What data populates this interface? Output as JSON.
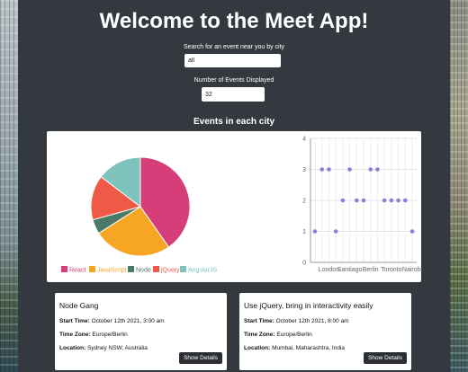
{
  "header": {
    "title": "Welcome to the Meet App!"
  },
  "search": {
    "label": "Search for an event near you by city",
    "value": "all"
  },
  "count": {
    "label": "Number of Events Displayed",
    "value": "32"
  },
  "charts": {
    "title": "Events in each city"
  },
  "chart_data": [
    {
      "type": "pie",
      "legend_position": "bottom",
      "slices": [
        {
          "label": "React",
          "value": 11,
          "color": "#d63e7a"
        },
        {
          "label": "JavaScript",
          "value": 7,
          "color": "#f6a623"
        },
        {
          "label": "Node",
          "value": 1.3,
          "color": "#4a7a66"
        },
        {
          "label": "jQuery",
          "value": 4,
          "color": "#ee5a45"
        },
        {
          "label": "AngularJS",
          "value": 4,
          "color": "#7ec4bc"
        }
      ]
    },
    {
      "type": "scatter",
      "point_color": "#8f7fd6",
      "x_tick_labels": [
        "London",
        "Santiago",
        "Berlin",
        "Toronto",
        "Nairobi"
      ],
      "ylim": [
        0,
        4
      ],
      "y_ticks": [
        "0",
        "1",
        "2",
        "3",
        "4"
      ],
      "grid": true,
      "points": [
        {
          "x": 0,
          "y": 1
        },
        {
          "x": 1,
          "y": 3
        },
        {
          "x": 2,
          "y": 3
        },
        {
          "x": 3,
          "y": 1
        },
        {
          "x": 4,
          "y": 2
        },
        {
          "x": 5,
          "y": 3
        },
        {
          "x": 6,
          "y": 2
        },
        {
          "x": 7,
          "y": 2
        },
        {
          "x": 8,
          "y": 3
        },
        {
          "x": 9,
          "y": 3
        },
        {
          "x": 10,
          "y": 2
        },
        {
          "x": 11,
          "y": 2
        },
        {
          "x": 12,
          "y": 2
        },
        {
          "x": 13,
          "y": 2
        },
        {
          "x": 14,
          "y": 1
        }
      ]
    }
  ],
  "events": [
    {
      "name": "Node Gang",
      "start_label": "Start Time:",
      "start": "October 12th 2021, 3:00 am",
      "tz_label": "Time Zone:",
      "tz": "Europe/Berlin",
      "loc_label": "Location:",
      "loc": "Sydney NSW, Australia",
      "button": "Show Details"
    },
    {
      "name": "Use jQuery, bring in interactivity easily",
      "start_label": "Start Time:",
      "start": "October 12th 2021, 8:00 am",
      "tz_label": "Time Zone:",
      "tz": "Europe/Berlin",
      "loc_label": "Location:",
      "loc": "Mumbai, Maharashtra, India",
      "button": "Show Details"
    }
  ]
}
